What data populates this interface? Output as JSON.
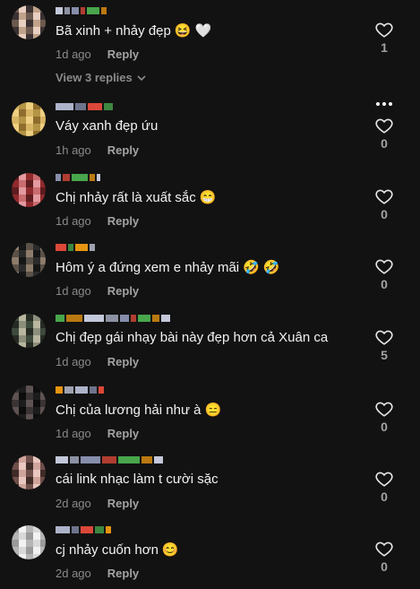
{
  "comments": [
    {
      "text": "Bã xinh + nhảy đẹp",
      "time": "1d ago",
      "reply": "Reply",
      "likes": "1",
      "view_replies": "View 3 replies",
      "emoji": [
        "😆",
        "🤍"
      ],
      "avatar_colors": [
        "#6d5a4e",
        "#c0a38a",
        "#3a3232",
        "#e8cfc0"
      ]
    },
    {
      "text": "Váy xanh đẹp ứu",
      "time": "1h ago",
      "reply": "Reply",
      "likes": "0",
      "emoji": [],
      "avatar_colors": [
        "#b49445",
        "#d7b565",
        "#8e6d2d",
        "#efcf80"
      ]
    },
    {
      "text": "Chị nhảy rất là xuất sắc",
      "time": "1d ago",
      "reply": "Reply",
      "likes": "0",
      "emoji": [
        "😁"
      ],
      "avatar_colors": [
        "#8f2a2d",
        "#e39aa0",
        "#5e1c1f",
        "#c96c6f"
      ]
    },
    {
      "text": "Hôm ý a đứng xem e nhảy mãi",
      "time": "1d ago",
      "reply": "Reply",
      "likes": "0",
      "emoji": [
        "🤣",
        "🤣"
      ],
      "avatar_colors": [
        "#2b2b2b",
        "#5a5148",
        "#161616",
        "#8e7c6b"
      ]
    },
    {
      "text": "Chị đẹp gái nhạy bài này đẹp hơn cả Xuân ca",
      "time": "1d ago",
      "reply": "Reply",
      "likes": "5",
      "emoji": [],
      "avatar_colors": [
        "#3d4a3c",
        "#8c8f7c",
        "#262b24",
        "#b9b6a0"
      ]
    },
    {
      "text": "Chị của lương hải như à",
      "time": "1d ago",
      "reply": "Reply",
      "likes": "0",
      "emoji": [
        "😑"
      ],
      "avatar_colors": [
        "#1c1c1c",
        "#3a3434",
        "#0d0d0d",
        "#5e5252"
      ]
    },
    {
      "text": "cái link nhạc làm t cười sặc",
      "time": "2d ago",
      "reply": "Reply",
      "likes": "0",
      "emoji": [],
      "avatar_colors": [
        "#6f4f4a",
        "#cfa49b",
        "#402b28",
        "#e9c6bf"
      ]
    },
    {
      "text": "cj nhảy cuốn hơn",
      "time": "2d ago",
      "reply": "Reply",
      "likes": "0",
      "emoji": [
        "😊"
      ],
      "avatar_colors": [
        "#d9d9d9",
        "#b5b5b5",
        "#f2f2f2",
        "#9a9a9a"
      ]
    }
  ],
  "colors": {
    "background": "#121212",
    "text": "#f2f2f2",
    "muted": "#8a8a8a"
  },
  "icons": {
    "like": "heart-outline-icon",
    "more": "more-dots-icon",
    "expand": "chevron-down-icon"
  }
}
